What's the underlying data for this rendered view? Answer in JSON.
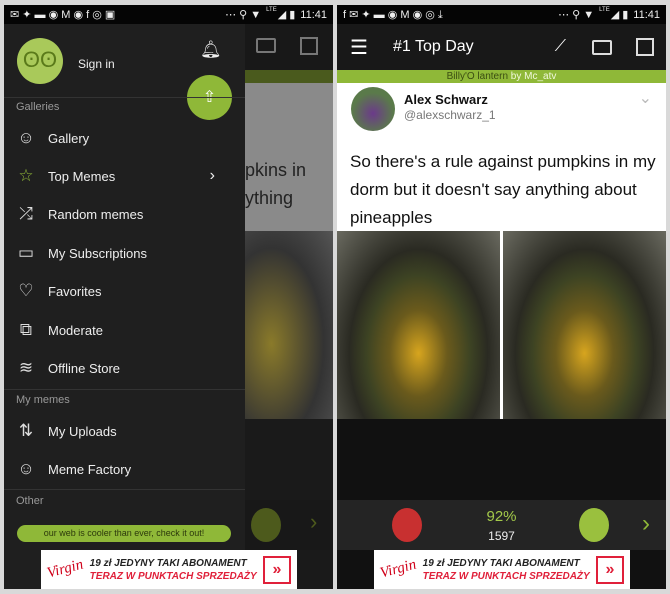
{
  "status": {
    "time": "11:41",
    "network": "LTE"
  },
  "left": {
    "drawer": {
      "sign_in": "Sign in",
      "sections": {
        "galleries": "Galleries",
        "my_memes": "My memes",
        "other": "Other"
      },
      "galleries": [
        {
          "label": "Gallery",
          "icon": "gallery-icon"
        },
        {
          "label": "Top Memes",
          "icon": "star-icon"
        },
        {
          "label": "Random memes",
          "icon": "shuffle-icon"
        },
        {
          "label": "My Subscriptions",
          "icon": "cast-icon"
        },
        {
          "label": "Favorites",
          "icon": "heart-icon"
        },
        {
          "label": "Moderate",
          "icon": "moderate-icon"
        },
        {
          "label": "Offline Store",
          "icon": "wifi-icon"
        }
      ],
      "my_memes": [
        {
          "label": "My Uploads",
          "icon": "sort-arrows-icon"
        },
        {
          "label": "Meme Factory",
          "icon": "meme-factory-icon"
        }
      ],
      "promo": "our web is cooler than ever, check it out!"
    },
    "behind_text": [
      "pkins in",
      "ything"
    ]
  },
  "right": {
    "header": {
      "title": "#1 Top Day"
    },
    "meme_bar": {
      "title": "Billy'O lantern",
      "author": "by Mc_atv"
    },
    "tweet": {
      "name": "Alex Schwarz",
      "handle": "@alexschwarz_1",
      "text": "So there's a rule against pumpkins in my dorm but it doesn't say anything about pineapples"
    },
    "rating": {
      "percent": "92%",
      "votes": "1597"
    }
  },
  "ad": {
    "line1": "19 zł JEDYNY TAKI ABONAMENT",
    "line2": "TERAZ W PUNKTACH SPRZEDAŻY",
    "brand": "Virgin",
    "cta": "»"
  },
  "colors": {
    "accent": "#8fb838",
    "drawer": "#1f1f1f",
    "header": "#181818"
  }
}
